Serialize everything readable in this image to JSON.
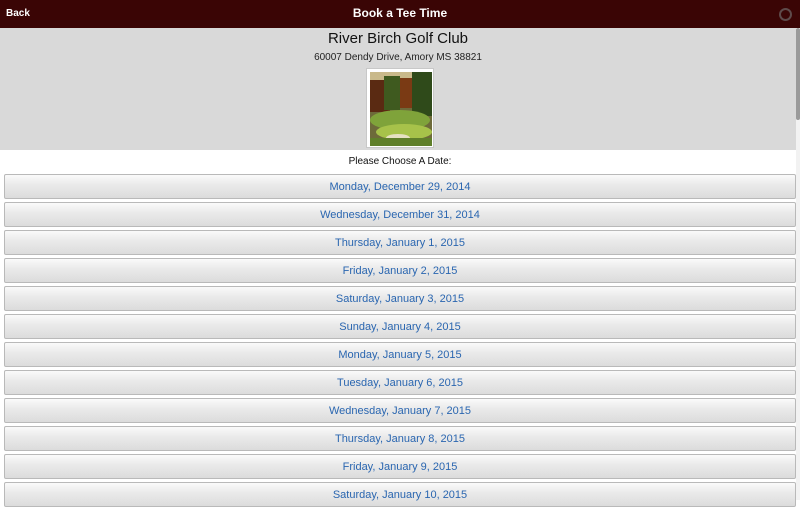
{
  "header": {
    "back_label": "Back",
    "title": "Book a Tee Time",
    "spinner_icon": "loading-spinner-icon"
  },
  "club": {
    "name": "River Birch Golf Club",
    "address": "60007 Dendy Drive, Amory MS 38821",
    "photo_icon": "golf-course-photo"
  },
  "prompt": "Please Choose A Date:",
  "dates": [
    "Monday, December 29, 2014",
    "Wednesday, December 31, 2014",
    "Thursday, January 1, 2015",
    "Friday, January 2, 2015",
    "Saturday, January 3, 2015",
    "Sunday, January 4, 2015",
    "Monday, January 5, 2015",
    "Tuesday, January 6, 2015",
    "Wednesday, January 7, 2015",
    "Thursday, January 8, 2015",
    "Friday, January 9, 2015",
    "Saturday, January 10, 2015"
  ],
  "colors": {
    "header_bg": "#3a0505",
    "link_blue": "#2a66b0",
    "panel_gray": "#d9d9d9"
  }
}
